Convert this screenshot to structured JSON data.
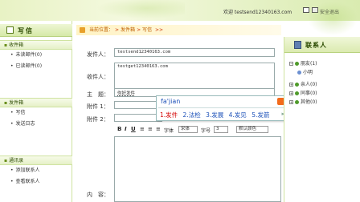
{
  "header": {
    "welcome_text": "欢迎 testsend12340163.com",
    "logout_label": "安全退出"
  },
  "sidebar": {
    "title": "写信",
    "sections": [
      {
        "title": "收件箱",
        "items": [
          "未读邮件(0)",
          "已读邮件(0)"
        ]
      },
      {
        "title": "发件箱",
        "items": [
          "写信",
          "发送日志"
        ]
      },
      {
        "title": "通讯录",
        "items": [
          "添加联系人",
          "查看联系人"
        ]
      }
    ]
  },
  "breadcrumb": {
    "prefix": "当前位置：",
    "path": [
      "发件箱",
      "写信"
    ],
    "suffix": ">>"
  },
  "form": {
    "sender_label": "发件人：",
    "sender_value": "testsend12340163.com",
    "recipient_label": "收件人：",
    "recipient_value": "testget12340163.com",
    "subject_label": "主　题：",
    "subject_value": "你好发件",
    "attach1_label": "附件 1：",
    "attach2_label": "附件 2：",
    "body_label": "内　容："
  },
  "ime": {
    "pinyin": "fa'jian",
    "candidates": [
      "1.发件",
      "2.法检",
      "3.发展",
      "4.发见",
      "5.发箭"
    ]
  },
  "toolbar": {
    "bold": "B",
    "italic": "I",
    "underline": "U",
    "font_label": "字体",
    "font_value": "宋体",
    "size_label": "字号",
    "size_value": "3",
    "color_value": "默认颜色"
  },
  "contacts": {
    "title": "联系人",
    "tree": [
      {
        "label": "朋友(1)",
        "expanded": true
      },
      {
        "label": "小明",
        "child": true
      },
      {
        "label": "亲人(0)",
        "expanded": false
      },
      {
        "label": "同事(0)",
        "expanded": false
      },
      {
        "label": "其他(0)",
        "expanded": false
      }
    ]
  }
}
